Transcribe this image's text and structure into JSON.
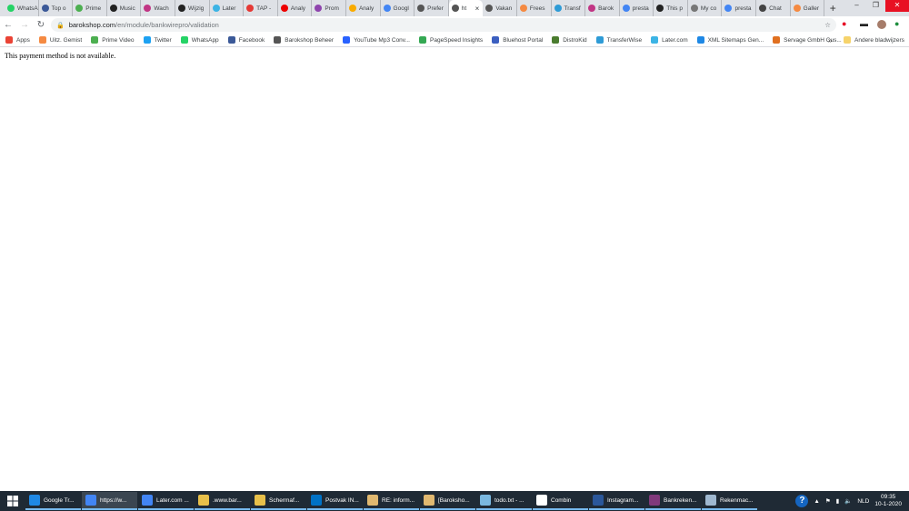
{
  "tabs": [
    {
      "label": "WhatsApp",
      "color": "#25d366"
    },
    {
      "label": "Top o",
      "color": "#3b5998"
    },
    {
      "label": "Prime",
      "color": "#4caf50"
    },
    {
      "label": "Music",
      "color": "#222"
    },
    {
      "label": "Wach",
      "color": "#c13584"
    },
    {
      "label": "Wijzig",
      "color": "#222"
    },
    {
      "label": "Later",
      "color": "#3cb4e5"
    },
    {
      "label": "TAP -",
      "color": "#e53935"
    },
    {
      "label": "Analy",
      "color": "#e00"
    },
    {
      "label": "Prom",
      "color": "#8e44ad"
    },
    {
      "label": "Analy",
      "color": "#f9ab00"
    },
    {
      "label": "Googl",
      "color": "#4285f4"
    },
    {
      "label": "Prefer",
      "color": "#555"
    },
    {
      "label": "ht",
      "color": "#555",
      "active": true
    },
    {
      "label": "Vakan",
      "color": "#555"
    },
    {
      "label": "Frees",
      "color": "#f58a42"
    },
    {
      "label": "Transf",
      "color": "#2e9bd6"
    },
    {
      "label": "Barok",
      "color": "#c13584"
    },
    {
      "label": "presta",
      "color": "#4285f4"
    },
    {
      "label": "This p",
      "color": "#222"
    },
    {
      "label": "My co",
      "color": "#777"
    },
    {
      "label": "presta",
      "color": "#4285f4"
    },
    {
      "label": "Chat",
      "color": "#444"
    },
    {
      "label": "Galler",
      "color": "#f58a42"
    }
  ],
  "new_tab": "+",
  "tab_close": "×",
  "window": {
    "minimize": "–",
    "restore": "❐",
    "close": "✕"
  },
  "url": {
    "host": "barokshop.com",
    "path": "/en/module/bankwirepro/validation"
  },
  "bookmarks": [
    {
      "label": "Apps",
      "color": "#ea4335"
    },
    {
      "label": "Uitz. Gemist",
      "color": "#f58a42"
    },
    {
      "label": "Prime Video",
      "color": "#4caf50"
    },
    {
      "label": "Twitter",
      "color": "#1da1f2"
    },
    {
      "label": "WhatsApp",
      "color": "#25d366"
    },
    {
      "label": "Facebook",
      "color": "#3b5998"
    },
    {
      "label": "Barokshop Beheer",
      "color": "#555"
    },
    {
      "label": "YouTube Mp3 Conv...",
      "color": "#2962ff"
    },
    {
      "label": "PageSpeed Insights",
      "color": "#34a853"
    },
    {
      "label": "Bluehost Portal",
      "color": "#3b5fc0"
    },
    {
      "label": "DistroKid",
      "color": "#4a7c2f"
    },
    {
      "label": "TransferWise",
      "color": "#2e9bd6"
    },
    {
      "label": "Later.com",
      "color": "#3cb4e5"
    },
    {
      "label": "XML Sitemaps Gen...",
      "color": "#1e88e5"
    },
    {
      "label": "Servage GmbH Cus...",
      "color": "#e07020"
    }
  ],
  "bookmarks_more": "»",
  "other_bookmarks": "Andere bladwijzers",
  "message": "This payment method is not available.",
  "taskbar": [
    {
      "label": "Google Tr...",
      "color": "#1e88e5"
    },
    {
      "label": "https://w...",
      "color": "#4285f4",
      "active": true
    },
    {
      "label": "Later.com ...",
      "color": "#4285f4"
    },
    {
      "label": ".www.bar...",
      "color": "#e8c04a"
    },
    {
      "label": "Schermaf...",
      "color": "#e8c04a"
    },
    {
      "label": "Postvak IN...",
      "color": "#0072c6"
    },
    {
      "label": "RE: inform...",
      "color": "#e0b870"
    },
    {
      "label": "[Baroksho...",
      "color": "#e0b870"
    },
    {
      "label": "todo.txt - ...",
      "color": "#7ab8e0"
    },
    {
      "label": "Combin",
      "color": "#ffffff"
    },
    {
      "label": "Instagram...",
      "color": "#2b579a"
    },
    {
      "label": "Bankreken...",
      "color": "#80397b"
    },
    {
      "label": "Rekenmac...",
      "color": "#9fb8d0"
    }
  ],
  "tray": {
    "help": "?",
    "language": "NLD",
    "time": "09:35",
    "date": "10-1-2020"
  }
}
